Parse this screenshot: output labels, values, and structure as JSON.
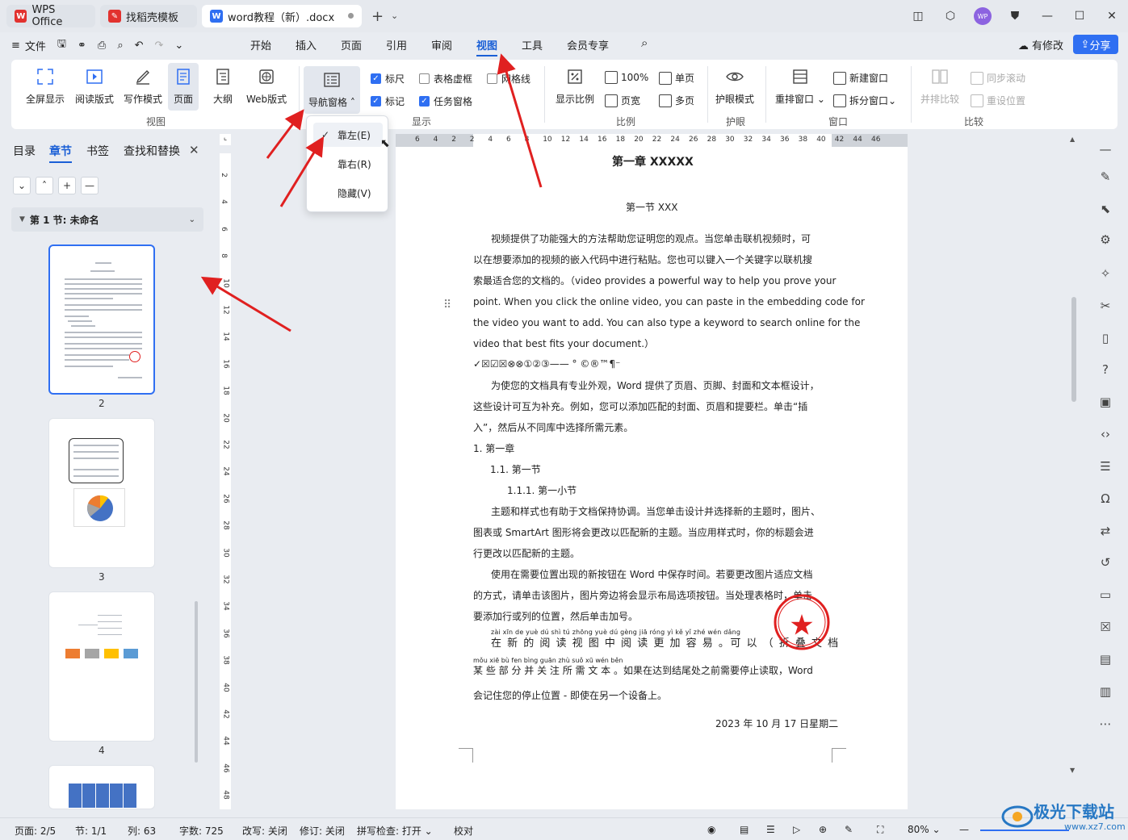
{
  "titlebar": {
    "tabs": [
      {
        "label": "WPS Office"
      },
      {
        "label": "找稻壳模板"
      },
      {
        "label": "word教程（新）.docx"
      }
    ],
    "avatar": "WP"
  },
  "menubar": {
    "file": "文件",
    "items": [
      "开始",
      "插入",
      "页面",
      "引用",
      "审阅",
      "视图",
      "工具",
      "会员专享"
    ],
    "active": "视图",
    "revise": "有修改",
    "share": "分享"
  },
  "ribbon": {
    "view_group": {
      "buttons": [
        "全屏显示",
        "阅读版式",
        "写作模式",
        "页面",
        "大纲",
        "Web版式"
      ],
      "label": "视图"
    },
    "show_group": {
      "nav_pane": "导航窗格",
      "checks": [
        {
          "label": "标尺",
          "checked": true
        },
        {
          "label": "表格虚框",
          "checked": false
        },
        {
          "label": "网格线",
          "checked": false
        },
        {
          "label": "标记",
          "checked": true
        },
        {
          "label": "任务窗格",
          "checked": true
        }
      ],
      "label": "显示"
    },
    "ratio_group": {
      "display_ratio": "显示比例",
      "hundred": "100%",
      "page_width": "页宽",
      "single": "单页",
      "multi": "多页",
      "label": "比例"
    },
    "eye_group": {
      "button": "护眼模式",
      "label": "护眼"
    },
    "window_group": {
      "rearrange": "重排窗口",
      "new_window": "新建窗口",
      "split": "拆分窗口",
      "label": "窗口"
    },
    "compare_group": {
      "side_by_side": "并排比较",
      "sync_scroll": "同步滚动",
      "reset_pos": "重设位置",
      "label": "比较"
    }
  },
  "dropdown": {
    "items": [
      {
        "label": "靠左(E)",
        "selected": true
      },
      {
        "label": "靠右(R)",
        "selected": false
      },
      {
        "label": "隐藏(V)",
        "selected": false
      }
    ]
  },
  "navpane": {
    "tabs": [
      "目录",
      "章节",
      "书签",
      "查找和替换"
    ],
    "active": "章节",
    "section": "第 1 节: 未命名",
    "pages": [
      "2",
      "3",
      "4"
    ]
  },
  "ruler": {
    "h_ticks": [
      "6",
      "4",
      "2",
      "2",
      "4",
      "6",
      "8",
      "10",
      "12",
      "14",
      "16",
      "18",
      "20",
      "22",
      "24",
      "26",
      "28",
      "30",
      "32",
      "34",
      "36",
      "38",
      "40",
      "42",
      "44",
      "46"
    ],
    "v_ticks": [
      "2",
      "4",
      "6",
      "8",
      "10",
      "12",
      "14",
      "16",
      "18",
      "20",
      "22",
      "24",
      "26",
      "28",
      "30",
      "32",
      "34",
      "36",
      "38",
      "40",
      "42",
      "44",
      "46",
      "48"
    ]
  },
  "document": {
    "chapter": "第一章  XXXXX",
    "section": "第一节  XXX",
    "p1": [
      "视频提供了功能强大的方法帮助您证明您的观点。当您单击联机视频时，可",
      "以在想要添加的视频的嵌入代码中进行粘贴。您也可以键入一个关键字以联机搜",
      "索最适合您的文档的。（video provides a powerful way to help you prove your",
      "point. When you click the online video, you can paste in the embedding code for",
      "the video you want to add. You can also type a keyword to search online for the",
      "video that best fits your document.）"
    ],
    "symbols": "✓☒☑☒⊗⊗①②③——    °  ©®™¶⁻",
    "p2": [
      "为使您的文档具有专业外观，Word 提供了页眉、页脚、封面和文本框设计，",
      "这些设计可互为补充。例如，您可以添加匹配的封面、页眉和提要栏。单击“插",
      "入”，然后从不同库中选择所需元素。"
    ],
    "list1": "1.   第一章",
    "list2": "1.1.  第一节",
    "list3": "1.1.1.   第一小节",
    "p3": [
      "主题和样式也有助于文档保持协调。当您单击设计并选择新的主题时，图片、",
      "图表或 SmartArt 图形将会更改以匹配新的主题。当应用样式时，你的标题会进",
      "行更改以匹配新的主题。"
    ],
    "p4": [
      "使用在需要位置出现的新按钮在 Word 中保存时间。若要更改图片适应文档",
      "的方式，请单击该图片，图片旁边将会显示布局选项按钮。当处理表格时，单击",
      "要添加行或列的位置，然后单击加号。"
    ],
    "pinyin1": "zài  xīn  de  yuè  dú  shì  tú   zhōng yuè  dú  gèng  jiā  róng   yì       kě   yǐ             zhé   wén  dǎng",
    "p5a": "在 新 的 阅 读 视 图 中 阅 读 更 加 容 易 。可 以 （ 折 叠 文 档",
    "pinyin2": "mǒu xiē  bù fen bìng guān zhù suǒ xū wén běn",
    "p5b": "某 些 部 分 并 关 注 所 需 文 本 。如果在达到结尾处之前需要停止读取，Word",
    "p5c": "会记住您的停止位置 - 即使在另一个设备上。",
    "date": "2023 年 10 月 17 日星期二",
    "stamp_text": "XXX有限公司(商务合同)"
  },
  "statusbar": {
    "page": "页面: 2/5",
    "section": "节: 1/1",
    "col": "列: 63",
    "words": "字数: 725",
    "overtype": "改写: 关闭",
    "revision": "修订: 关闭",
    "spell": "拼写检查: 打开",
    "proof": "校对",
    "zoom": "80%"
  },
  "watermark": {
    "text": "极光下载站",
    "sub": "www.xz7.com"
  },
  "colors": {
    "accent": "#2f6ff2",
    "arrow": "#e02020",
    "stamp": "#e02020"
  }
}
